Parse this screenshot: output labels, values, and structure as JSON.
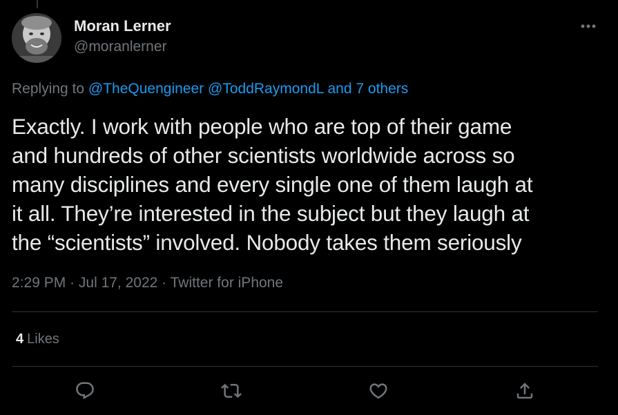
{
  "author": {
    "name": "Moran Lerner",
    "handle": "@moranlerner"
  },
  "reply_context": {
    "prefix": "Replying to",
    "mention_1": "@TheQuengineer",
    "mention_2": "@ToddRaymondL",
    "others": "and 7 others"
  },
  "tweet": {
    "lines": [
      "Exactly. I work with people who are top of their game",
      "and hundreds of other scientists worldwide across so",
      "many disciplines and every single one of them laugh at",
      "it all. They’re interested in the subject but they laugh at",
      "the “scientists” involved. Nobody takes them seriously"
    ]
  },
  "meta": {
    "time": "2:29 PM",
    "separator_1": " · ",
    "date": "Jul 17, 2022",
    "separator_2": " · ",
    "source": "Twitter for iPhone"
  },
  "stats": {
    "likes_count": "4",
    "likes_label": "Likes"
  },
  "actions": [
    {
      "name": "reply",
      "icon": "reply-icon"
    },
    {
      "name": "retweet",
      "icon": "retweet-icon"
    },
    {
      "name": "like",
      "icon": "heart-icon"
    },
    {
      "name": "share",
      "icon": "share-icon"
    }
  ],
  "colors": {
    "background": "#000000",
    "text": "#e7e9ea",
    "secondary": "#71767b",
    "link": "#1d9bf0",
    "divider": "#2f3336"
  }
}
